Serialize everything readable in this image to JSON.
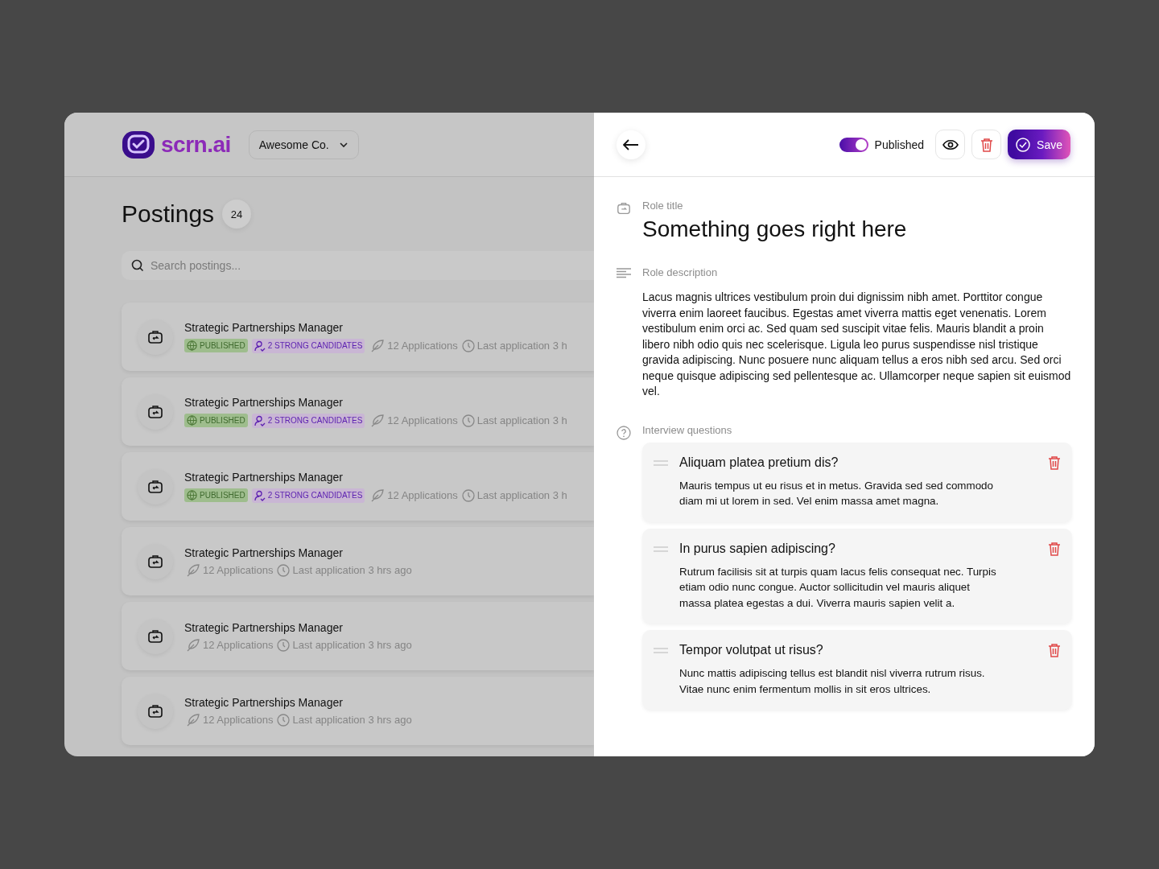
{
  "brand": {
    "name": "scrn.ai"
  },
  "company_selector": {
    "value": "Awesome Co."
  },
  "postings": {
    "title": "Postings",
    "count": "24",
    "search": {
      "placeholder": "Search postings..."
    },
    "items": [
      {
        "title": "Strategic Partnerships Manager",
        "published_tag": "PUBLISHED",
        "candidates_tag": "2 STRONG CANDIDATES",
        "applications": "12 Applications",
        "last_application": "Last application 3 h"
      },
      {
        "title": "Strategic Partnerships Manager",
        "published_tag": "PUBLISHED",
        "candidates_tag": "2 STRONG CANDIDATES",
        "applications": "12 Applications",
        "last_application": "Last application 3 h"
      },
      {
        "title": "Strategic Partnerships Manager",
        "published_tag": "PUBLISHED",
        "candidates_tag": "2 STRONG CANDIDATES",
        "applications": "12 Applications",
        "last_application": "Last application 3 h"
      },
      {
        "title": "Strategic Partnerships Manager",
        "applications": "12 Applications",
        "last_application": "Last application 3 hrs ago"
      },
      {
        "title": "Strategic Partnerships Manager",
        "applications": "12 Applications",
        "last_application": "Last application 3 hrs ago"
      },
      {
        "title": "Strategic Partnerships Manager",
        "applications": "12 Applications",
        "last_application": "Last application 3 hrs ago"
      }
    ]
  },
  "editor": {
    "published_toggle": {
      "label": "Published",
      "on": true
    },
    "save_button": "Save",
    "role_title": {
      "label": "Role title",
      "value": "Something goes right here"
    },
    "role_description": {
      "label": "Role description",
      "value": "Lacus magnis ultrices vestibulum proin dui dignissim nibh amet. Porttitor congue viverra enim laoreet faucibus. Egestas amet viverra mattis eget venenatis. Lorem vestibulum enim orci ac. Sed quam sed suscipit vitae felis. Mauris blandit a proin libero nibh odio quis nec scelerisque. Ligula leo purus suspendisse nisl tristique gravida adipiscing. Nunc posuere nunc aliquam tellus a eros nibh sed arcu. Sed orci neque quisque adipiscing sed pellentesque ac. Ullamcorper neque sapien sit euismod vel."
    },
    "interview_questions": {
      "label": "Interview questions",
      "items": [
        {
          "question": "Aliquam platea pretium dis?",
          "answer": "Mauris tempus ut eu risus et in metus. Gravida sed sed commodo diam mi ut lorem in sed. Vel enim massa amet magna."
        },
        {
          "question": "In purus sapien adipiscing?",
          "answer": "Rutrum facilisis sit at turpis quam lacus felis consequat nec. Turpis etiam odio nunc congue. Auctor sollicitudin vel mauris aliquet massa platea egestas a dui. Viverra mauris sapien velit a."
        },
        {
          "question": "Tempor volutpat ut risus?",
          "answer": "Nunc mattis adipiscing tellus est blandit nisl viverra rutrum risus. Vitae nunc enim fermentum mollis in sit eros ultrices."
        }
      ]
    }
  }
}
